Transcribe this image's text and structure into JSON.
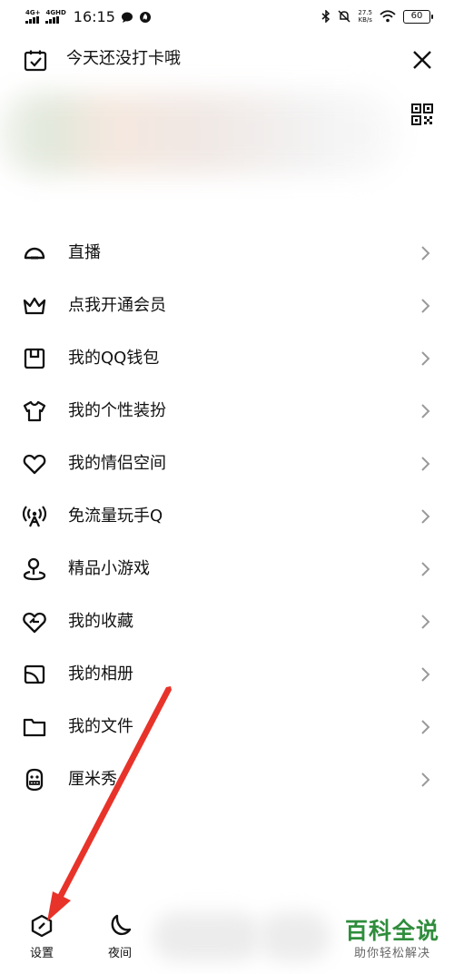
{
  "status_bar": {
    "sim1": "4G+",
    "sim2": "4GHD",
    "time": "16:15",
    "net_speed_value": "27.5",
    "net_speed_unit": "KB/s",
    "battery": "60"
  },
  "header": {
    "title": "今天还没打卡哦"
  },
  "menu": {
    "items": [
      {
        "label": "直播",
        "icon": "live-icon"
      },
      {
        "label": "点我开通会员",
        "icon": "crown-icon"
      },
      {
        "label": "我的QQ钱包",
        "icon": "wallet-icon"
      },
      {
        "label": "我的个性装扮",
        "icon": "tshirt-icon"
      },
      {
        "label": "我的情侣空间",
        "icon": "heart-icon"
      },
      {
        "label": "免流量玩手Q",
        "icon": "antenna-icon"
      },
      {
        "label": "精品小游戏",
        "icon": "game-pin-icon"
      },
      {
        "label": "我的收藏",
        "icon": "favorite-icon"
      },
      {
        "label": "我的相册",
        "icon": "album-icon"
      },
      {
        "label": "我的文件",
        "icon": "folder-icon"
      },
      {
        "label": "厘米秀",
        "icon": "cmshow-face-icon"
      }
    ]
  },
  "bottom_bar": {
    "settings_label": "设置",
    "night_label": "夜间"
  },
  "watermark": {
    "title": "百科全说",
    "subtitle": "助你轻松解决"
  },
  "colors": {
    "text": "#111111",
    "chevron": "#9a9a9a",
    "annotation_arrow": "#e8332a",
    "watermark_green": "#2f8d3c"
  }
}
